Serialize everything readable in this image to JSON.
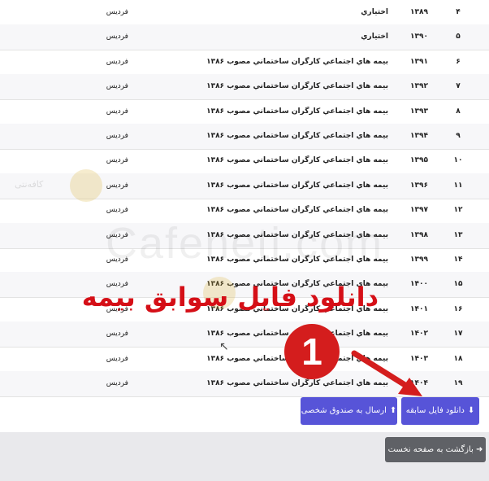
{
  "table": {
    "rows": [
      {
        "idx": "۴",
        "year": "۱۳۸۹",
        "type": "اختياري",
        "fund": "فرديس"
      },
      {
        "idx": "۵",
        "year": "۱۳۹۰",
        "type": "اختياري",
        "fund": "فرديس"
      },
      {
        "idx": "۶",
        "year": "۱۳۹۱",
        "type": "بيمه هاي اجتماعي كارگران ساختماني مصوب ۱۳۸۶",
        "fund": "فرديس"
      },
      {
        "idx": "۷",
        "year": "۱۳۹۲",
        "type": "بيمه هاي اجتماعي كارگران ساختماني مصوب ۱۳۸۶",
        "fund": "فرديس"
      },
      {
        "idx": "۸",
        "year": "۱۳۹۳",
        "type": "بيمه هاي اجتماعي كارگران ساختماني مصوب ۱۳۸۶",
        "fund": "فرديس"
      },
      {
        "idx": "۹",
        "year": "۱۳۹۴",
        "type": "بيمه هاي اجتماعي كارگران ساختماني مصوب ۱۳۸۶",
        "fund": "فرديس"
      },
      {
        "idx": "۱۰",
        "year": "۱۳۹۵",
        "type": "بيمه هاي اجتماعي كارگران ساختماني مصوب ۱۳۸۶",
        "fund": "فرديس"
      },
      {
        "idx": "۱۱",
        "year": "۱۳۹۶",
        "type": "بيمه هاي اجتماعي كارگران ساختماني مصوب ۱۳۸۶",
        "fund": "فرديس"
      },
      {
        "idx": "۱۲",
        "year": "۱۳۹۷",
        "type": "بيمه هاي اجتماعي كارگران ساختماني مصوب ۱۳۸۶",
        "fund": "فرديس"
      },
      {
        "idx": "۱۳",
        "year": "۱۳۹۸",
        "type": "بيمه هاي اجتماعي كارگران ساختماني مصوب ۱۳۸۶",
        "fund": "فرديس"
      },
      {
        "idx": "۱۴",
        "year": "۱۳۹۹",
        "type": "بيمه هاي اجتماعي كارگران ساختماني مصوب ۱۳۸۶",
        "fund": "فرديس"
      },
      {
        "idx": "۱۵",
        "year": "۱۴۰۰",
        "type": "بيمه هاي اجتماعي كارگران ساختماني مصوب ۱۳۸۶",
        "fund": "فرديس"
      },
      {
        "idx": "۱۶",
        "year": "۱۴۰۱",
        "type": "بيمه هاي اجتماعي كارگران ساختماني مصوب ۱۳۸۶",
        "fund": "فرديس"
      },
      {
        "idx": "۱۷",
        "year": "۱۴۰۲",
        "type": "بيمه هاي اجتماعي كارگران ساختماني مصوب ۱۳۸۶",
        "fund": "فرديس"
      },
      {
        "idx": "۱۸",
        "year": "۱۴۰۳",
        "type": "بيمه هاي اجتماعي كارگران ساختماني مصوب ۱۳۸۶",
        "fund": "فرديس"
      },
      {
        "idx": "۱۹",
        "year": "۱۴۰۴",
        "type": "بيمه هاي اجتماعي كارگران ساختماني مصوب ۱۳۸۶",
        "fund": "فرديس"
      }
    ]
  },
  "actions": {
    "download_label": "دانلود فايل سابقه",
    "send_label": "ارسال به صندوق شخصی",
    "back_label": "بازگشت به صفحه نخست"
  },
  "overlay": {
    "title": "دانلود فایل سوابق بیمه",
    "step_number": "1",
    "watermark": "Cafeneti.com",
    "logo_text": "کافه‌نتی"
  },
  "colors": {
    "primary_button": "#5754d8",
    "secondary_button": "#5f6166",
    "overlay_red": "#d50f17"
  }
}
